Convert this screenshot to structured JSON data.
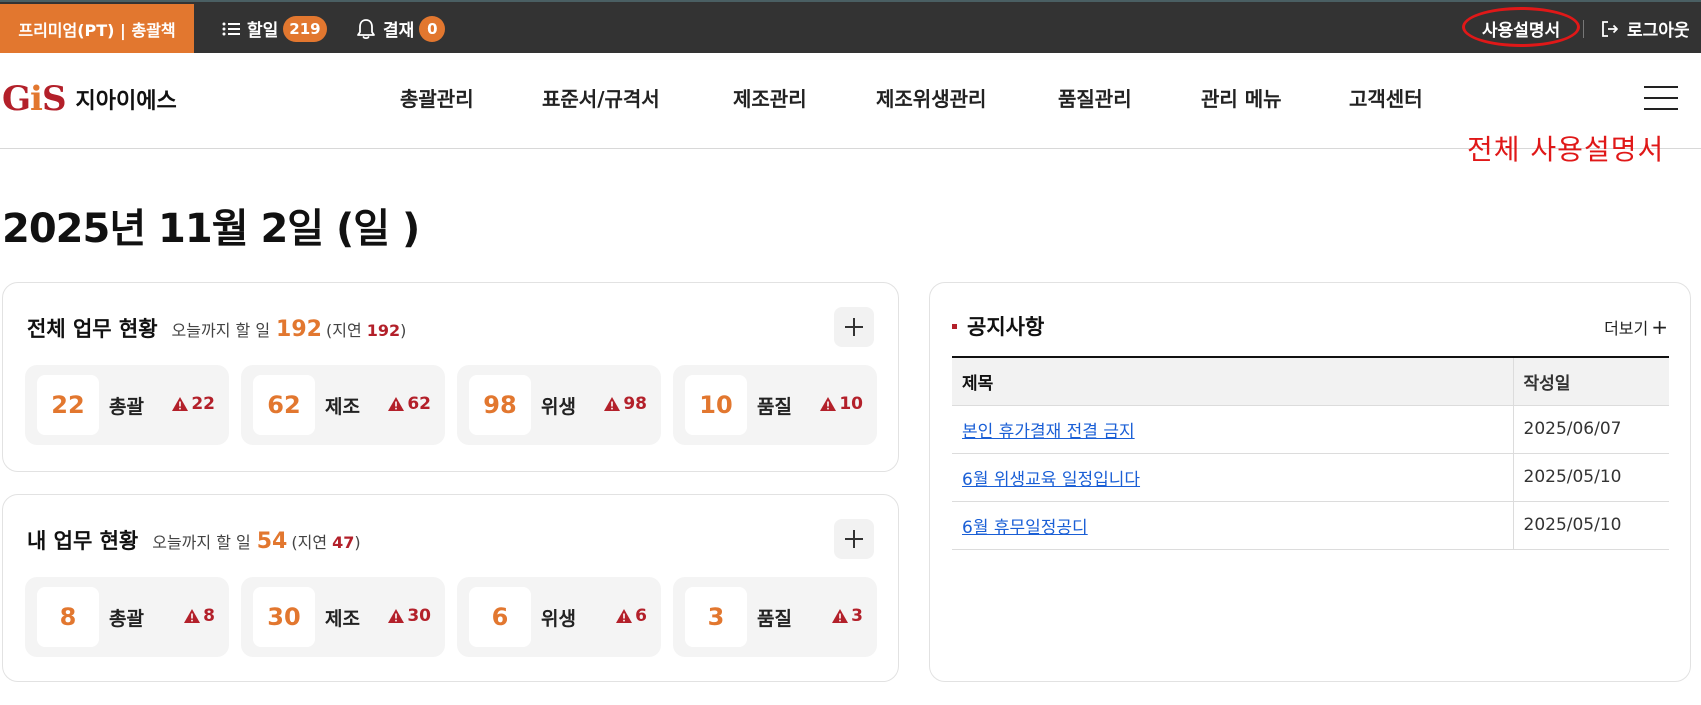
{
  "topbar": {
    "plan_label": "프리미엄(PT) | 총괄책",
    "todo_label": "할일",
    "todo_count": "219",
    "approval_label": "결재",
    "approval_count": "0",
    "manual_label": "사용설명서",
    "logout_label": "로그아웃"
  },
  "header": {
    "logo_mark_g": "G",
    "logo_mark_i": "i",
    "logo_mark_s": "S",
    "logo_text": "지아이에스",
    "nav": [
      "총괄관리",
      "표준서/규격서",
      "제조관리",
      "제조위생관리",
      "품질관리",
      "관리 메뉴",
      "고객센터"
    ]
  },
  "annotation": {
    "text": "전체 사용설명서",
    "color": "#e01818"
  },
  "date_title": "2025년 11월 2일 (일 )",
  "all_tasks": {
    "title": "전체 업무 현황",
    "sub": "오늘까지 할 일",
    "count": "192",
    "delay_prefix": "(지연",
    "delay_count": "192",
    "delay_suffix": ")",
    "cards": [
      {
        "num": "22",
        "label": "총괄",
        "warn": "22"
      },
      {
        "num": "62",
        "label": "제조",
        "warn": "62"
      },
      {
        "num": "98",
        "label": "위생",
        "warn": "98"
      },
      {
        "num": "10",
        "label": "품질",
        "warn": "10"
      }
    ]
  },
  "my_tasks": {
    "title": "내 업무 현황",
    "sub": "오늘까지 할 일",
    "count": "54",
    "delay_prefix": "(지연",
    "delay_count": "47",
    "delay_suffix": ")",
    "cards": [
      {
        "num": "8",
        "label": "총괄",
        "warn": "8"
      },
      {
        "num": "30",
        "label": "제조",
        "warn": "30"
      },
      {
        "num": "6",
        "label": "위생",
        "warn": "6"
      },
      {
        "num": "3",
        "label": "품질",
        "warn": "3"
      }
    ]
  },
  "notice": {
    "title": "공지사항",
    "more_label": "더보기",
    "col_title": "제목",
    "col_date": "작성일",
    "rows": [
      {
        "title": "본인 휴가결재 전결 금지",
        "date": "2025/06/07"
      },
      {
        "title": "6월 위생교육 일정입니다",
        "date": "2025/05/10"
      },
      {
        "title": "6월 휴무일정공디",
        "date": "2025/05/10"
      }
    ]
  },
  "colors": {
    "accent": "#e2772f",
    "brand_red": "#b3202a",
    "topbar_bg": "#333333",
    "link": "#1a5fd6"
  },
  "icons": {
    "todo": "list-icon",
    "approval": "bell-icon",
    "logout": "logout-icon",
    "menu": "hamburger-icon",
    "add": "plus-icon",
    "warning": "warning-triangle-icon"
  }
}
